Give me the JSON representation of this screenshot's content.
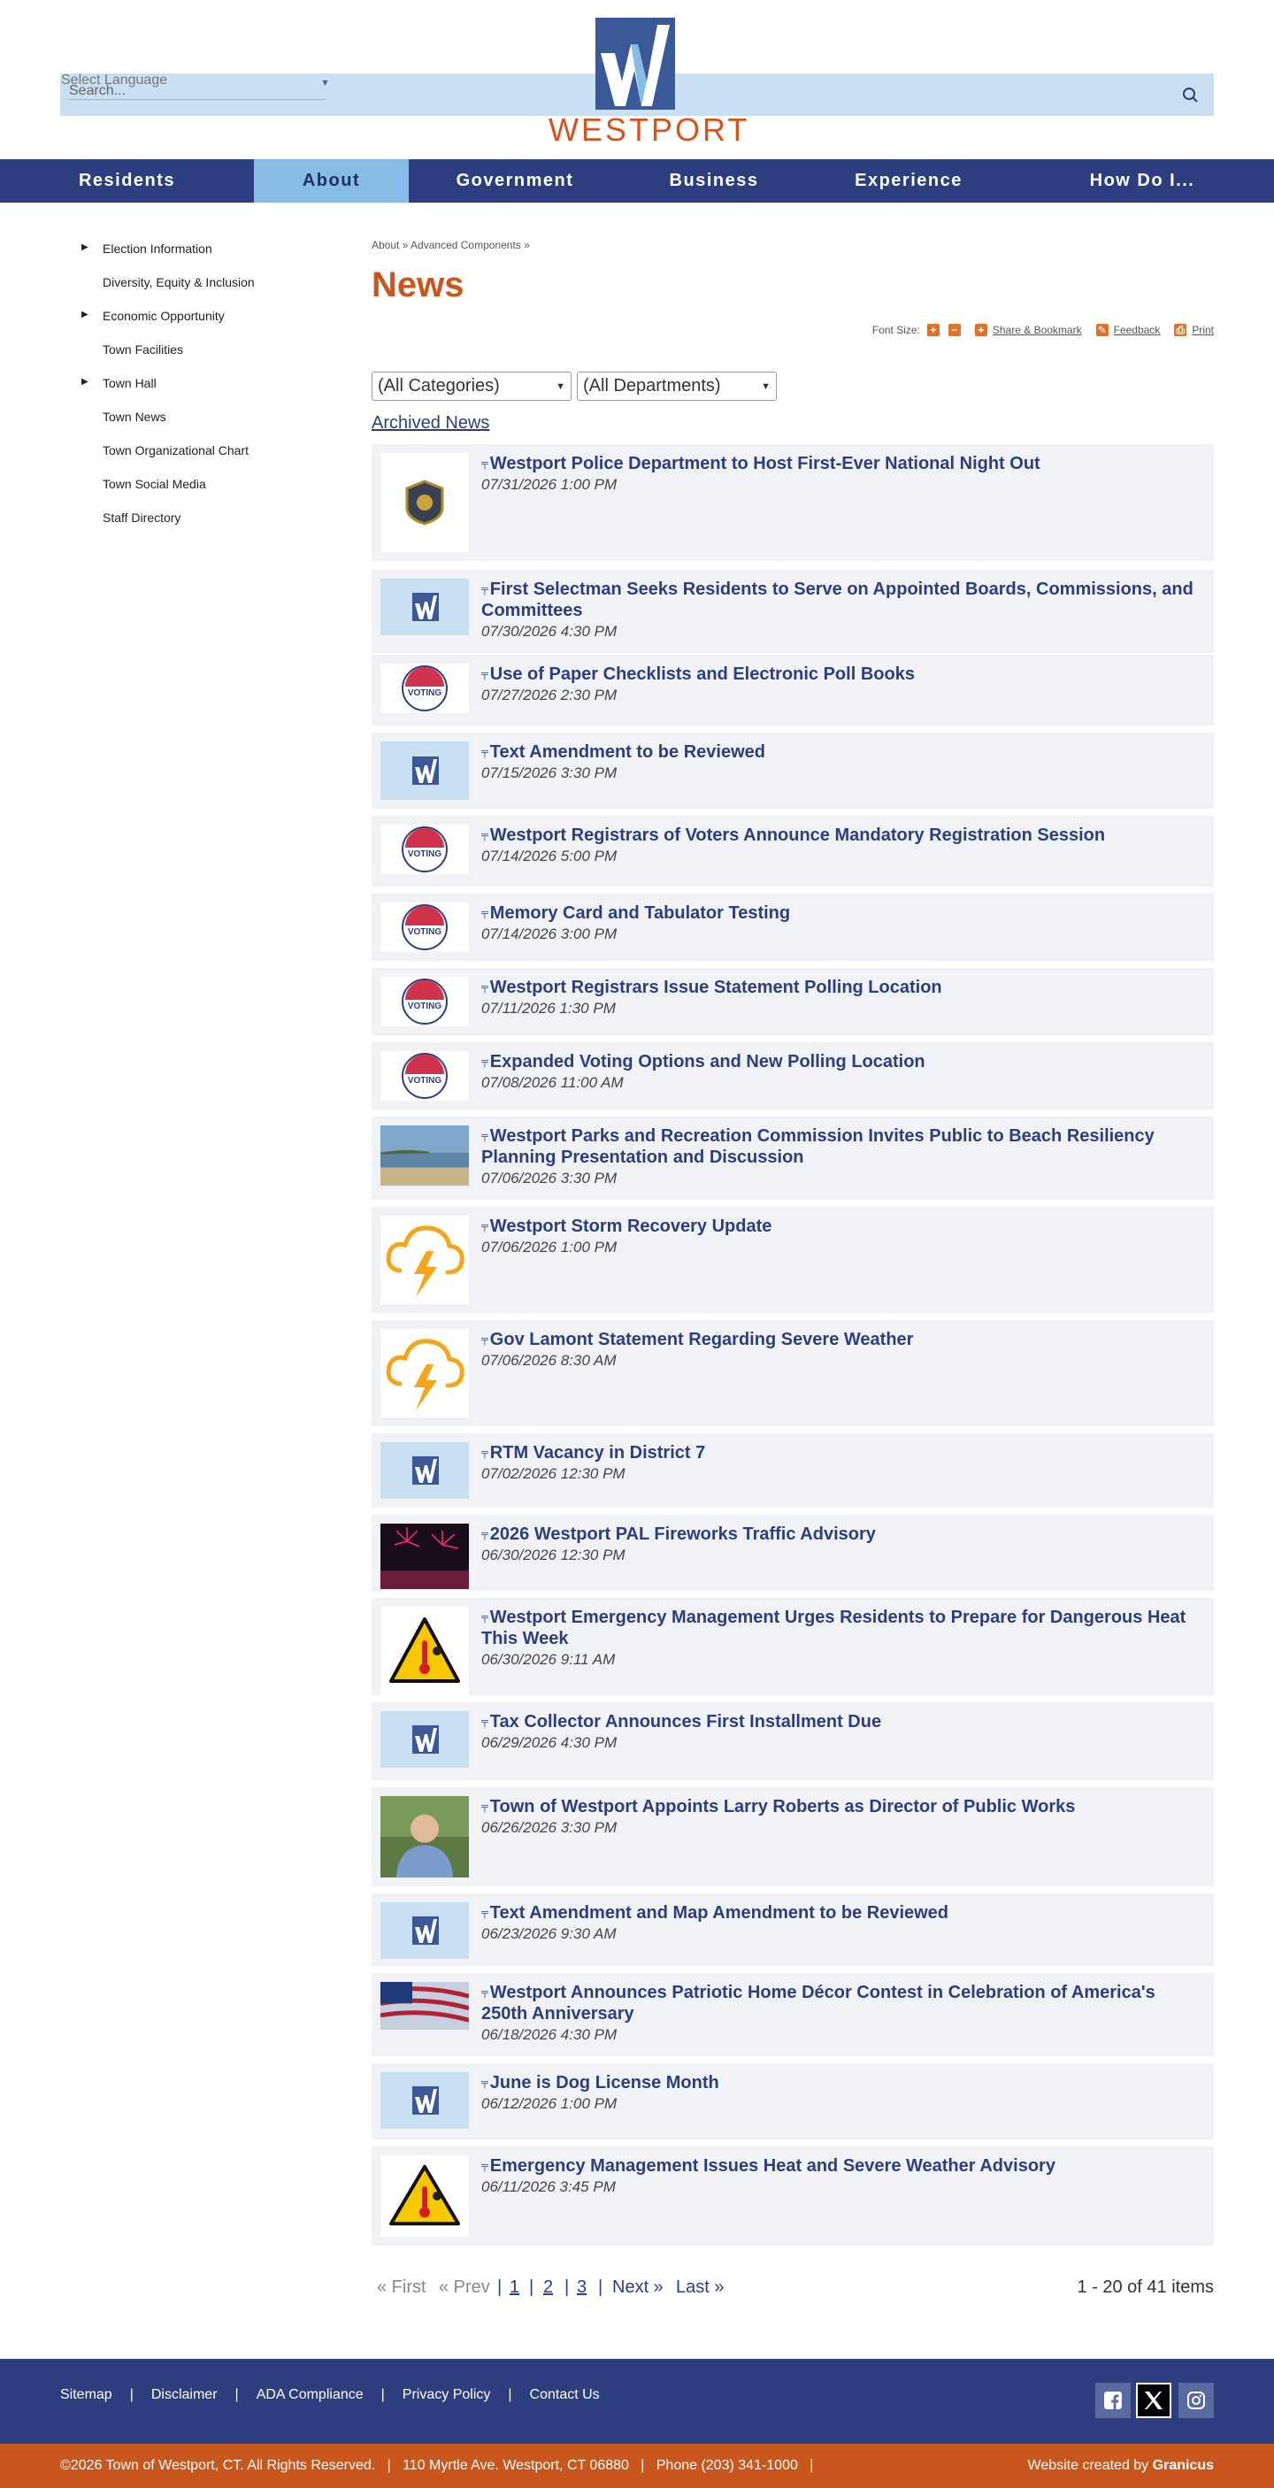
{
  "header": {
    "language_label": "Select Language",
    "search_placeholder": "Search...",
    "logo_text": "WESTPORT",
    "brand_colors": {
      "navy": "#2c3e7e",
      "orange": "#c9561c",
      "light_blue": "#86bce5"
    }
  },
  "nav": {
    "items": [
      {
        "label": "Residents",
        "active": false
      },
      {
        "label": "About",
        "active": true
      },
      {
        "label": "Government",
        "active": false
      },
      {
        "label": "Business",
        "active": false
      },
      {
        "label": "Experience",
        "active": false
      },
      {
        "label": "How Do I...",
        "active": false
      }
    ]
  },
  "sidebar": {
    "items": [
      {
        "label": "Election Information",
        "expandable": true
      },
      {
        "label": "Diversity, Equity & Inclusion",
        "expandable": false
      },
      {
        "label": "Economic Opportunity",
        "expandable": true
      },
      {
        "label": "Town Facilities",
        "expandable": false
      },
      {
        "label": "Town Hall",
        "expandable": true
      },
      {
        "label": "Town News",
        "expandable": false
      },
      {
        "label": "Town Organizational Chart",
        "expandable": false
      },
      {
        "label": "Town Social Media",
        "expandable": false
      },
      {
        "label": "Staff Directory",
        "expandable": false
      }
    ]
  },
  "main": {
    "breadcrumb": "About » Advanced Components »",
    "title": "News",
    "tools": {
      "font_size_label": "Font Size:",
      "share_label": "Share & Bookmark",
      "feedback_label": "Feedback",
      "print_label": "Print"
    },
    "filters": {
      "categories": "(All Categories)",
      "departments": "(All Departments)"
    },
    "archived_link": "Archived News",
    "news": [
      {
        "title": "Westport Police Department to Host First-Ever National Night Out",
        "date": "07/31/2026 1:00 PM",
        "thumb": "police-badge"
      },
      {
        "title": "First Selectman Seeks Residents to Serve on Appointed Boards, Commissions, and Committees",
        "date": "07/30/2026 4:30 PM",
        "thumb": "westport-logo"
      },
      {
        "title": "Use of Paper Checklists and Electronic Poll Books",
        "date": "07/27/2026 2:30 PM",
        "thumb": "voting-seal"
      },
      {
        "title": "Text Amendment to be Reviewed",
        "date": "07/15/2026 3:30 PM",
        "thumb": "westport-logo"
      },
      {
        "title": "Westport Registrars of Voters Announce Mandatory Registration Session",
        "date": "07/14/2026 5:00 PM",
        "thumb": "voting-seal"
      },
      {
        "title": "Memory Card and Tabulator Testing",
        "date": "07/14/2026 3:00 PM",
        "thumb": "voting-seal"
      },
      {
        "title": "Westport Registrars Issue Statement Polling Location",
        "date": "07/11/2026 1:30 PM",
        "thumb": "voting-seal"
      },
      {
        "title": "Expanded Voting Options and New Polling Location",
        "date": "07/08/2026 11:00 AM",
        "thumb": "voting-seal"
      },
      {
        "title": "Westport Parks and Recreation Commission Invites Public to Beach Resiliency Planning Presentation and Discussion",
        "date": "07/06/2026 3:30 PM",
        "thumb": "beach-photo"
      },
      {
        "title": "Westport Storm Recovery Update",
        "date": "07/06/2026 1:00 PM",
        "thumb": "storm-icon"
      },
      {
        "title": "Gov Lamont Statement Regarding Severe Weather",
        "date": "07/06/2026 8:30 AM",
        "thumb": "storm-icon"
      },
      {
        "title": "RTM Vacancy in District 7",
        "date": "07/02/2026 12:30 PM",
        "thumb": "westport-logo"
      },
      {
        "title": "2026 Westport PAL Fireworks Traffic Advisory",
        "date": "06/30/2026 12:30 PM",
        "thumb": "fireworks-photo"
      },
      {
        "title": "Westport Emergency Management Urges Residents to Prepare for Dangerous Heat This Week",
        "date": "06/30/2026 9:11 AM",
        "thumb": "heat-warning"
      },
      {
        "title": "Tax Collector Announces First Installment Due",
        "date": "06/29/2026 4:30 PM",
        "thumb": "westport-logo"
      },
      {
        "title": "Town of Westport Appoints Larry Roberts as Director of Public Works",
        "date": "06/26/2026 3:30 PM",
        "thumb": "portrait-photo"
      },
      {
        "title": "Text Amendment and Map Amendment to be Reviewed",
        "date": "06/23/2026 9:30 AM",
        "thumb": "westport-logo"
      },
      {
        "title": "Westport Announces Patriotic Home Décor Contest in Celebration of America's 250th Anniversary",
        "date": "06/18/2026 4:30 PM",
        "thumb": "flag-photo"
      },
      {
        "title": "June is Dog License Month",
        "date": "06/12/2026 1:00 PM",
        "thumb": "westport-logo"
      },
      {
        "title": "Emergency Management Issues Heat and Severe Weather Advisory",
        "date": "06/11/2026 3:45 PM",
        "thumb": "heat-warning"
      }
    ],
    "pagination": {
      "first": "« First",
      "prev": "« Prev",
      "pages": [
        "1",
        "2",
        "3"
      ],
      "next": "Next »",
      "last": "Last »",
      "separator": "|",
      "summary": "1 - 20 of 41 items"
    }
  },
  "footer": {
    "links": [
      "Sitemap",
      "Disclaimer",
      "ADA Compliance",
      "Privacy Policy",
      "Contact Us"
    ],
    "separator": "|",
    "social": [
      "facebook-icon",
      "x-icon",
      "instagram-icon"
    ],
    "copyright": "©2026 Town of Westport, CT. All Rights Reserved.   |   110 Myrtle Ave. Westport, CT 06880   |   Phone (203) 341-1000   |",
    "credit_prefix": "Website created by",
    "credit_brand": "Granicus"
  }
}
